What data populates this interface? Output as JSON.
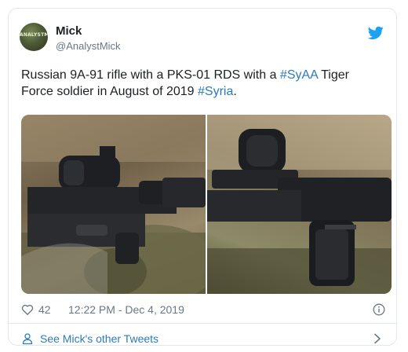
{
  "user": {
    "name": "Mick",
    "handle": "@AnalystMick",
    "avatar_text": "ANALYSTMICK"
  },
  "tweet": {
    "text_part1": "Russian 9A-91 rifle with a PKS-01 RDS with a ",
    "hashtag1": "#SyAA",
    "text_part2": " Tiger Force soldier in August of 2019 ",
    "hashtag2": "#Syria",
    "text_part3": "."
  },
  "meta": {
    "likes": "42",
    "time": "12:22 PM - Dec 4, 2019"
  },
  "footer": {
    "see_more": "See Mick's other Tweets"
  },
  "colors": {
    "link": "#2b7bb9",
    "twitter_blue": "#1da1f2",
    "muted": "#697882",
    "border": "#e1e8ed"
  },
  "icons": [
    "twitter-bird-icon",
    "heart-icon",
    "info-icon",
    "person-icon",
    "chevron-right-icon"
  ]
}
